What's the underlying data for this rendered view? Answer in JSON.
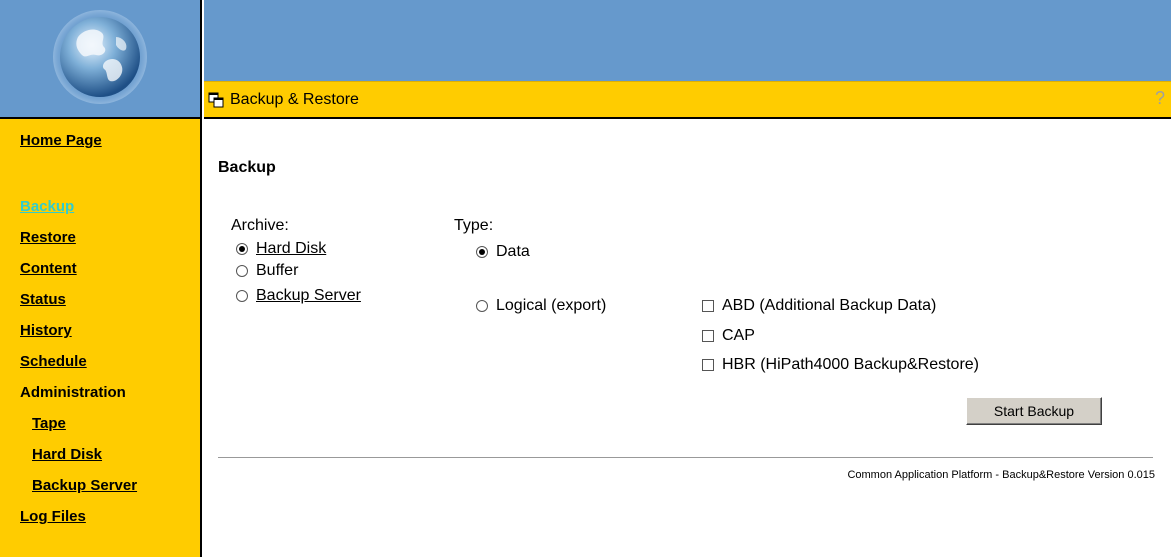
{
  "header": {
    "title": "Backup & Restore",
    "help_icon": "?"
  },
  "sidebar": {
    "items": [
      {
        "label": "Home Page"
      },
      {
        "label": "Backup"
      },
      {
        "label": "Restore"
      },
      {
        "label": "Content"
      },
      {
        "label": "Status"
      },
      {
        "label": "History"
      },
      {
        "label": "Schedule"
      },
      {
        "label": "Administration"
      },
      {
        "label": "Tape"
      },
      {
        "label": "Hard Disk"
      },
      {
        "label": "Backup Server"
      },
      {
        "label": "Log Files"
      }
    ]
  },
  "main": {
    "heading": "Backup",
    "archive": {
      "label": "Archive:",
      "options": [
        "Hard Disk",
        "Buffer",
        "Backup Server"
      ],
      "selected": "Hard Disk"
    },
    "type": {
      "label": "Type:",
      "options": [
        "Data",
        "Logical (export)"
      ],
      "selected": "Data"
    },
    "checkboxes": [
      "ABD (Additional Backup Data)",
      "CAP",
      "HBR (HiPath4000 Backup&Restore)"
    ],
    "start_button": "Start Backup",
    "footer": "Common Application Platform - Backup&Restore Version 0.015"
  },
  "colors": {
    "header_blue": "#6699cc",
    "nav_yellow": "#ffcc00",
    "active_link": "#33cccc"
  }
}
